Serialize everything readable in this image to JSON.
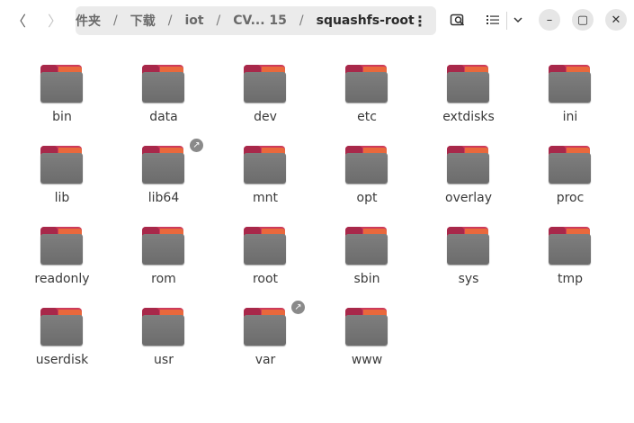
{
  "window": {
    "back_icon": "〈",
    "forward_icon": "〉",
    "path_menu_icon": "⋮",
    "minimize_icon": "–",
    "maximize_icon": "▢",
    "close_icon": "✕",
    "dropdown_icon": "⌄"
  },
  "pathbar": {
    "crumbs": [
      "件夹",
      "下载",
      "iot",
      "CV... 15",
      "squashfs-root"
    ],
    "separator": "/"
  },
  "folders": [
    {
      "name": "bin",
      "link": false
    },
    {
      "name": "data",
      "link": false
    },
    {
      "name": "dev",
      "link": false
    },
    {
      "name": "etc",
      "link": false
    },
    {
      "name": "extdisks",
      "link": false
    },
    {
      "name": "ini",
      "link": false
    },
    {
      "name": "lib",
      "link": false
    },
    {
      "name": "lib64",
      "link": true
    },
    {
      "name": "mnt",
      "link": false
    },
    {
      "name": "opt",
      "link": false
    },
    {
      "name": "overlay",
      "link": false
    },
    {
      "name": "proc",
      "link": false
    },
    {
      "name": "readonly",
      "link": false
    },
    {
      "name": "rom",
      "link": false
    },
    {
      "name": "root",
      "link": false
    },
    {
      "name": "sbin",
      "link": false
    },
    {
      "name": "sys",
      "link": false
    },
    {
      "name": "tmp",
      "link": false
    },
    {
      "name": "userdisk",
      "link": false
    },
    {
      "name": "usr",
      "link": false
    },
    {
      "name": "var",
      "link": true
    },
    {
      "name": "www",
      "link": false
    }
  ],
  "link_badge_icon": "↗",
  "colors": {
    "folder_tab": "#cc3b5a",
    "folder_accent": "#e9683c",
    "folder_body": "#737373"
  }
}
